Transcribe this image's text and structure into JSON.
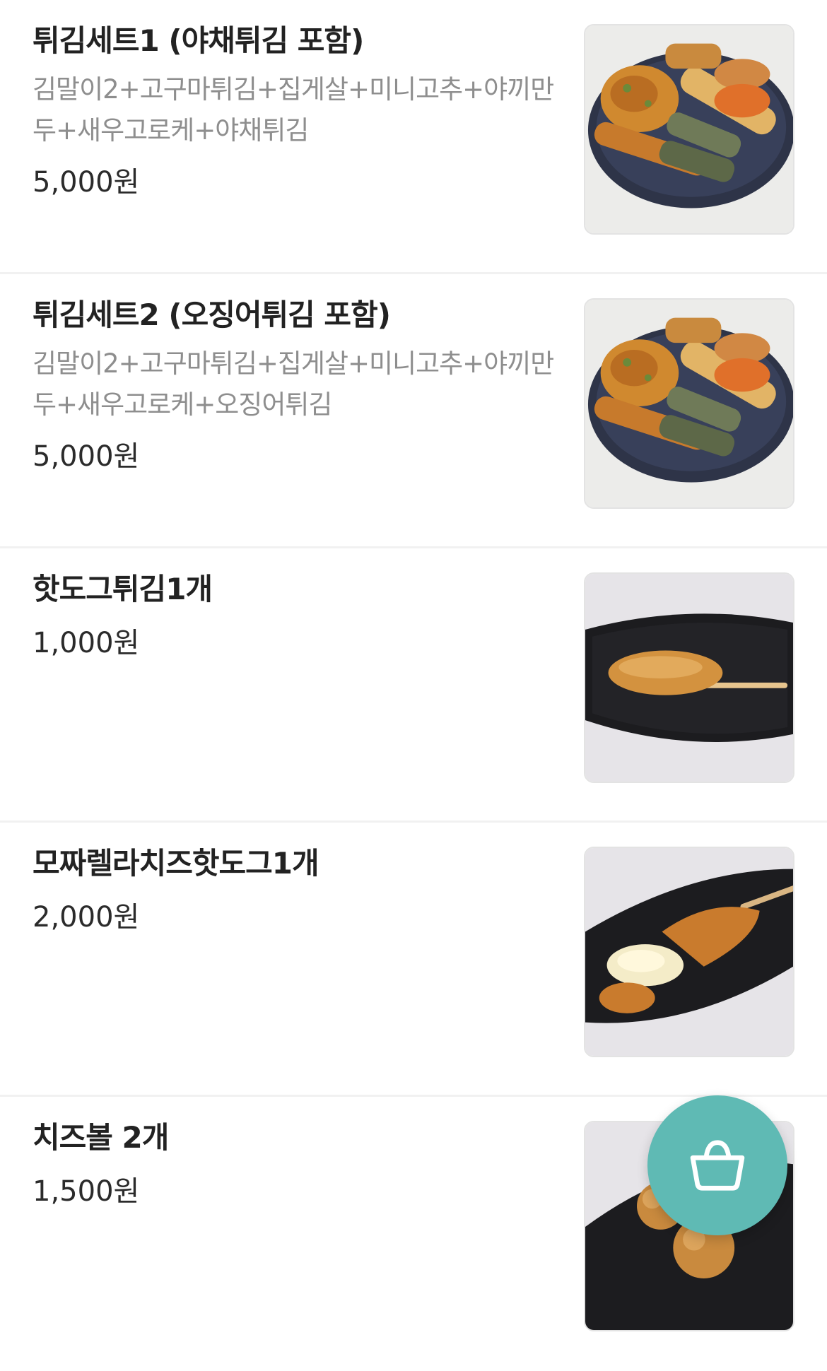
{
  "menu": {
    "items": [
      {
        "name": "튀김세트1 (야채튀김 포함)",
        "description": "김말이2+고구마튀김+집게살+미니고추+야끼만두+새우고로케+야채튀김",
        "price": "5,000원",
        "image_icon": "fried-food-platter-image"
      },
      {
        "name": "튀김세트2 (오징어튀김 포함)",
        "description": "김말이2+고구마튀김+집게살+미니고추+야끼만두+새우고로케+오징어튀김",
        "price": "5,000원",
        "image_icon": "fried-food-platter-image"
      },
      {
        "name": "핫도그튀김1개",
        "description": "",
        "price": "1,000원",
        "image_icon": "hotdog-image"
      },
      {
        "name": "모짜렐라치즈핫도그1개",
        "description": "",
        "price": "2,000원",
        "image_icon": "cheese-hotdog-image"
      },
      {
        "name": "치즈볼 2개",
        "description": "",
        "price": "1,500원",
        "image_icon": "cheese-ball-image"
      }
    ]
  },
  "cart_button": {
    "icon": "basket-icon"
  },
  "colors": {
    "accent": "#5fbab4",
    "title": "#222222",
    "description": "#8e8e8e",
    "divider": "#f1f1f1"
  }
}
